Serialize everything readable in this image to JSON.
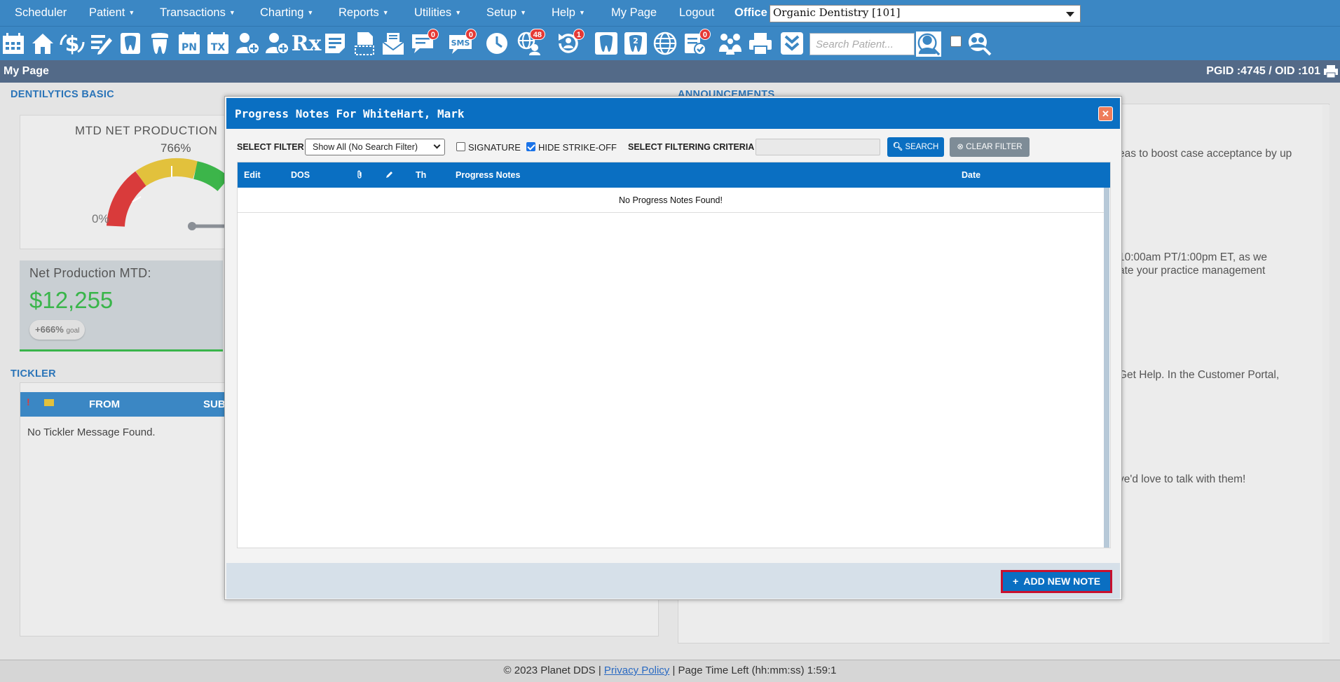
{
  "menu": {
    "items": [
      {
        "label": "Scheduler",
        "has_dropdown": false
      },
      {
        "label": "Patient",
        "has_dropdown": true
      },
      {
        "label": "Transactions",
        "has_dropdown": true
      },
      {
        "label": "Charting",
        "has_dropdown": true
      },
      {
        "label": "Reports",
        "has_dropdown": true
      },
      {
        "label": "Utilities",
        "has_dropdown": true
      },
      {
        "label": "Setup",
        "has_dropdown": true
      },
      {
        "label": "Help",
        "has_dropdown": true
      },
      {
        "label": "My Page",
        "has_dropdown": false
      },
      {
        "label": "Logout",
        "has_dropdown": false
      }
    ],
    "office_label": "Office",
    "office_value": "Organic Dentistry [101]"
  },
  "toolbar": {
    "tools": [
      {
        "icon": "calendar-icon"
      },
      {
        "icon": "home-icon"
      },
      {
        "icon": "dollar-icon"
      },
      {
        "icon": "edit-list-icon"
      },
      {
        "icon": "tooth-chart-icon"
      },
      {
        "icon": "tooth-icon"
      },
      {
        "icon": "pn-icon",
        "text": "PN"
      },
      {
        "icon": "tx-icon",
        "text": "TX"
      },
      {
        "icon": "add-patient-icon"
      },
      {
        "icon": "add-patient-2-icon"
      },
      {
        "icon": "rx-icon",
        "text": "Rx"
      },
      {
        "icon": "notes-icon"
      },
      {
        "icon": "document-scan-icon"
      },
      {
        "icon": "mail-icon"
      },
      {
        "icon": "chat-icon",
        "badge": "0"
      },
      {
        "icon": "sms-icon",
        "badge": "0"
      },
      {
        "icon": "clock-icon"
      },
      {
        "icon": "web-users-icon",
        "badge": "48"
      },
      {
        "icon": "recall-icon",
        "badge": "1"
      },
      {
        "icon": "tooth-outline-icon"
      },
      {
        "icon": "tooth-two-icon"
      },
      {
        "icon": "globe-icon"
      },
      {
        "icon": "clipboard-check-icon",
        "badge": "0"
      },
      {
        "icon": "family-icon"
      },
      {
        "icon": "printer-icon"
      },
      {
        "icon": "chevron-double-down-icon"
      }
    ],
    "search_placeholder": "Search Patient..."
  },
  "page": {
    "title": "My Page",
    "ids": "PGID :4745  /  OID :101"
  },
  "dashboard": {
    "dentilytics_title": "DENTILYTICS BASIC",
    "gauge_title": "MTD NET PRODUCTION",
    "gauge_percent": "766%",
    "gauge_zero": "0%",
    "net_label": "Net Production MTD:",
    "net_value": "$12,255",
    "net_goal": "+666%",
    "net_goal_suffix": "goal",
    "tickler_title": "TICKLER",
    "tickler_columns": [
      "FROM",
      "SUB"
    ],
    "tickler_empty": "No Tickler Message Found.",
    "announcements_title": "ANNOUNCEMENTS",
    "announcements": [
      "eas to boost case acceptance by up",
      "10:00am PT/1:00pm ET, as we",
      "ate your practice management",
      "Get Help. In the Customer Portal,",
      "ve'd love to talk with them!"
    ]
  },
  "modal": {
    "title": "Progress Notes For WhiteHart, Mark",
    "filter_label": "SELECT FILTER",
    "filter_value": "Show All (No Search Filter)",
    "signature_label": "SIGNATURE",
    "signature_checked": false,
    "hide_strike_label": "HIDE STRIKE-OFF",
    "hide_strike_checked": true,
    "criteria_label": "SELECT FILTERING CRITERIA",
    "criteria_value": "",
    "search_button": "SEARCH",
    "clear_button": "CLEAR FILTER",
    "columns": {
      "edit": "Edit",
      "dos": "DOS",
      "attach_icon": "paperclip-icon",
      "pencil_icon": "pencil-icon",
      "th": "Th",
      "notes": "Progress Notes",
      "date": "Date"
    },
    "empty_message": "No Progress Notes Found!",
    "add_button": "ADD NEW NOTE"
  },
  "footer": {
    "copyright": "© 2023 Planet DDS |",
    "privacy_link": "Privacy Policy",
    "page_time": "|  Page Time Left (hh:mm:ss) 1:59:1"
  },
  "colors": {
    "menu_blue": "#3b87c4",
    "modal_blue": "#0a6fc2",
    "header_gray": "#536a88",
    "green": "#39b54a",
    "highlight_red": "#c8102e"
  }
}
